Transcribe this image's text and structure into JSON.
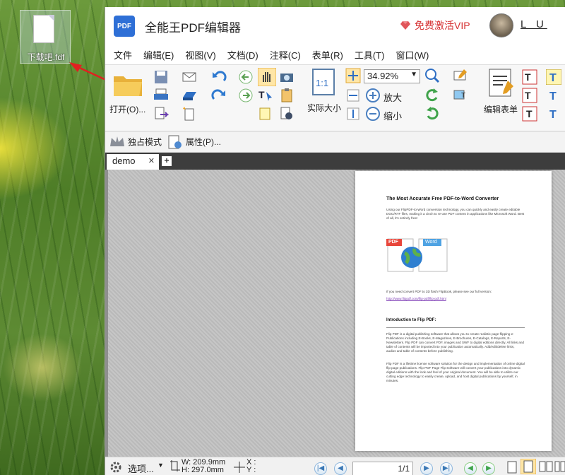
{
  "desktop": {
    "file_name": "下载吧.fdf"
  },
  "window": {
    "title": "全能王PDF编辑器",
    "logo_text": "PDF",
    "vip_label": "免费激活VIP",
    "user_name": "L U",
    "accent": "#2e6fd6",
    "vip_color": "#d63031"
  },
  "menu": [
    "文件",
    "编辑(E)",
    "视图(V)",
    "文档(D)",
    "注释(C)",
    "表单(R)",
    "工具(T)",
    "窗口(W)"
  ],
  "ribbon": {
    "open_label": "打开(O)...",
    "actual_size_label": "实际大小",
    "zoom_value": "34.92%",
    "zoom_in_label": "放大",
    "zoom_out_label": "缩小",
    "edit_form_label": "编辑表单"
  },
  "toolbar2": {
    "exclusive_mode": "独占模式",
    "properties": "属性(P)..."
  },
  "tabs": [
    {
      "label": "demo"
    }
  ],
  "document": {
    "heading": "The Most Accurate Free PDF-to-Word Converter",
    "para1": "Using our FlipPDF-to-Word conversion technology, you can quickly and easily create editable DOC/RTF files, making it a cinch to re-use PDF content in applications like Microsoft Word. Best of all, it's entirely free!",
    "badge_pdf": "PDF",
    "badge_word": "Word",
    "para2": "If you need convert PDF to 3D flash FlipBook, please see our full version:",
    "link": "http://www.flippdf.com/flip-pdf/flip-pdf.html",
    "heading2": "Introduction to  Flip PDF:",
    "para3": "Flip PDF is a digital publishing software that allows you to create realistic page-flipping e-Publications including E-Books, E-Magazines, E-Brochures, E-Catalogs, E-Reports, E-Newsletters. Flip PDF can convert PDF, images and SWF to digital editions directly. All links and table of contents will be imported into your publication automatically. Add/edit/delete links, audios and table of contents before publishing.",
    "para4": "Flip PDF is a lifetime license software solution for the design and implementation of online digital flip page publications. Flip PDF Page Flip Software will convert your publications into dynamic digital editions with the look and feel of your original document. You will be able to utilize our cutting edge technology to easily create, upload, and host digital publications by yourself, in minutes."
  },
  "status": {
    "options_label": "选项...",
    "width": "W: 209.9mm",
    "height": "H: 297.0mm",
    "x_label": "X :",
    "y_label": "Y :",
    "page_indicator": "1/1"
  }
}
